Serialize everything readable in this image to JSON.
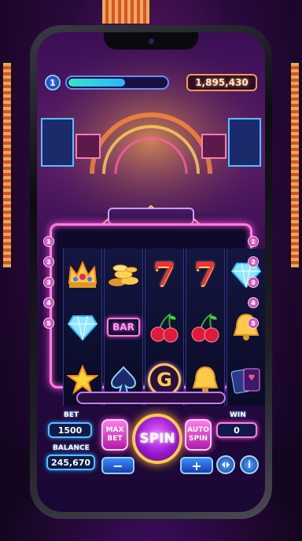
{
  "header": {
    "level": "1",
    "xp_progress": 0.58,
    "coins": "1,895,430"
  },
  "reels": [
    [
      "crown-icon",
      "diamond-icon",
      "star-icon"
    ],
    [
      "coins-icon",
      "bar-icon",
      "spade-icon"
    ],
    [
      "seven-icon",
      "cherries-icon",
      "g-icon"
    ],
    [
      "seven-icon",
      "cherries-icon",
      "bell-icon"
    ],
    [
      "diamond-icon",
      "bell-icon",
      "cards-icon"
    ]
  ],
  "symbols": {
    "bar_label": "BAR",
    "g_label": "G",
    "seven_label": "7"
  },
  "paylines": {
    "left": [
      "1",
      "2",
      "3",
      "4",
      "5"
    ],
    "right": [
      "1",
      "2",
      "3",
      "4",
      "5"
    ]
  },
  "controls": {
    "bet_label": "BET",
    "bet_value": "1500",
    "balance_label": "BALANCE",
    "balance_value": "245,670",
    "max_bet_label": "MAX BET",
    "spin_label": "SPIN",
    "auto_spin_label": "AUTO SPIN",
    "win_label": "WIN",
    "win_value": "0",
    "minus_label": "−",
    "plus_label": "+",
    "info_label": "i"
  },
  "colors": {
    "accent_pink": "#ff4fd8",
    "accent_blue": "#4fc3ff",
    "gold": "#ffc94a"
  }
}
